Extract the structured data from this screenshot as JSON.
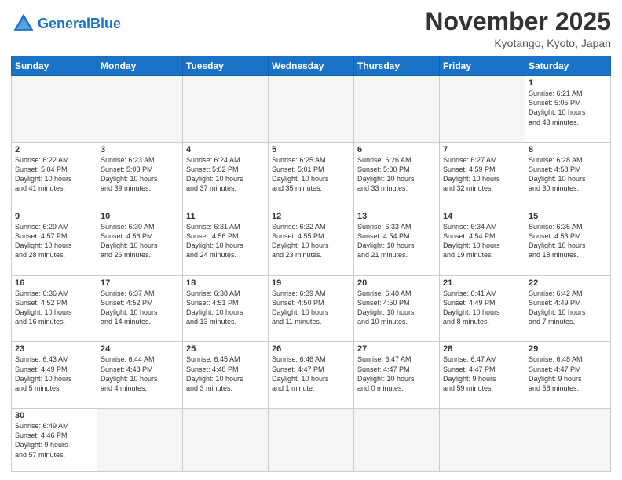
{
  "header": {
    "logo_general": "General",
    "logo_blue": "Blue",
    "month_title": "November 2025",
    "location": "Kyotango, Kyoto, Japan"
  },
  "weekdays": [
    "Sunday",
    "Monday",
    "Tuesday",
    "Wednesday",
    "Thursday",
    "Friday",
    "Saturday"
  ],
  "weeks": [
    [
      {
        "day": "",
        "info": ""
      },
      {
        "day": "",
        "info": ""
      },
      {
        "day": "",
        "info": ""
      },
      {
        "day": "",
        "info": ""
      },
      {
        "day": "",
        "info": ""
      },
      {
        "day": "",
        "info": ""
      },
      {
        "day": "1",
        "info": "Sunrise: 6:21 AM\nSunset: 5:05 PM\nDaylight: 10 hours\nand 43 minutes."
      }
    ],
    [
      {
        "day": "2",
        "info": "Sunrise: 6:22 AM\nSunset: 5:04 PM\nDaylight: 10 hours\nand 41 minutes."
      },
      {
        "day": "3",
        "info": "Sunrise: 6:23 AM\nSunset: 5:03 PM\nDaylight: 10 hours\nand 39 minutes."
      },
      {
        "day": "4",
        "info": "Sunrise: 6:24 AM\nSunset: 5:02 PM\nDaylight: 10 hours\nand 37 minutes."
      },
      {
        "day": "5",
        "info": "Sunrise: 6:25 AM\nSunset: 5:01 PM\nDaylight: 10 hours\nand 35 minutes."
      },
      {
        "day": "6",
        "info": "Sunrise: 6:26 AM\nSunset: 5:00 PM\nDaylight: 10 hours\nand 33 minutes."
      },
      {
        "day": "7",
        "info": "Sunrise: 6:27 AM\nSunset: 4:59 PM\nDaylight: 10 hours\nand 32 minutes."
      },
      {
        "day": "8",
        "info": "Sunrise: 6:28 AM\nSunset: 4:58 PM\nDaylight: 10 hours\nand 30 minutes."
      }
    ],
    [
      {
        "day": "9",
        "info": "Sunrise: 6:29 AM\nSunset: 4:57 PM\nDaylight: 10 hours\nand 28 minutes."
      },
      {
        "day": "10",
        "info": "Sunrise: 6:30 AM\nSunset: 4:56 PM\nDaylight: 10 hours\nand 26 minutes."
      },
      {
        "day": "11",
        "info": "Sunrise: 6:31 AM\nSunset: 4:56 PM\nDaylight: 10 hours\nand 24 minutes."
      },
      {
        "day": "12",
        "info": "Sunrise: 6:32 AM\nSunset: 4:55 PM\nDaylight: 10 hours\nand 23 minutes."
      },
      {
        "day": "13",
        "info": "Sunrise: 6:33 AM\nSunset: 4:54 PM\nDaylight: 10 hours\nand 21 minutes."
      },
      {
        "day": "14",
        "info": "Sunrise: 6:34 AM\nSunset: 4:54 PM\nDaylight: 10 hours\nand 19 minutes."
      },
      {
        "day": "15",
        "info": "Sunrise: 6:35 AM\nSunset: 4:53 PM\nDaylight: 10 hours\nand 18 minutes."
      }
    ],
    [
      {
        "day": "16",
        "info": "Sunrise: 6:36 AM\nSunset: 4:52 PM\nDaylight: 10 hours\nand 16 minutes."
      },
      {
        "day": "17",
        "info": "Sunrise: 6:37 AM\nSunset: 4:52 PM\nDaylight: 10 hours\nand 14 minutes."
      },
      {
        "day": "18",
        "info": "Sunrise: 6:38 AM\nSunset: 4:51 PM\nDaylight: 10 hours\nand 13 minutes."
      },
      {
        "day": "19",
        "info": "Sunrise: 6:39 AM\nSunset: 4:50 PM\nDaylight: 10 hours\nand 11 minutes."
      },
      {
        "day": "20",
        "info": "Sunrise: 6:40 AM\nSunset: 4:50 PM\nDaylight: 10 hours\nand 10 minutes."
      },
      {
        "day": "21",
        "info": "Sunrise: 6:41 AM\nSunset: 4:49 PM\nDaylight: 10 hours\nand 8 minutes."
      },
      {
        "day": "22",
        "info": "Sunrise: 6:42 AM\nSunset: 4:49 PM\nDaylight: 10 hours\nand 7 minutes."
      }
    ],
    [
      {
        "day": "23",
        "info": "Sunrise: 6:43 AM\nSunset: 4:49 PM\nDaylight: 10 hours\nand 5 minutes."
      },
      {
        "day": "24",
        "info": "Sunrise: 6:44 AM\nSunset: 4:48 PM\nDaylight: 10 hours\nand 4 minutes."
      },
      {
        "day": "25",
        "info": "Sunrise: 6:45 AM\nSunset: 4:48 PM\nDaylight: 10 hours\nand 3 minutes."
      },
      {
        "day": "26",
        "info": "Sunrise: 6:46 AM\nSunset: 4:47 PM\nDaylight: 10 hours\nand 1 minute."
      },
      {
        "day": "27",
        "info": "Sunrise: 6:47 AM\nSunset: 4:47 PM\nDaylight: 10 hours\nand 0 minutes."
      },
      {
        "day": "28",
        "info": "Sunrise: 6:47 AM\nSunset: 4:47 PM\nDaylight: 9 hours\nand 59 minutes."
      },
      {
        "day": "29",
        "info": "Sunrise: 6:48 AM\nSunset: 4:47 PM\nDaylight: 9 hours\nand 58 minutes."
      }
    ],
    [
      {
        "day": "30",
        "info": "Sunrise: 6:49 AM\nSunset: 4:46 PM\nDaylight: 9 hours\nand 57 minutes."
      },
      {
        "day": "",
        "info": ""
      },
      {
        "day": "",
        "info": ""
      },
      {
        "day": "",
        "info": ""
      },
      {
        "day": "",
        "info": ""
      },
      {
        "day": "",
        "info": ""
      },
      {
        "day": "",
        "info": ""
      }
    ]
  ]
}
